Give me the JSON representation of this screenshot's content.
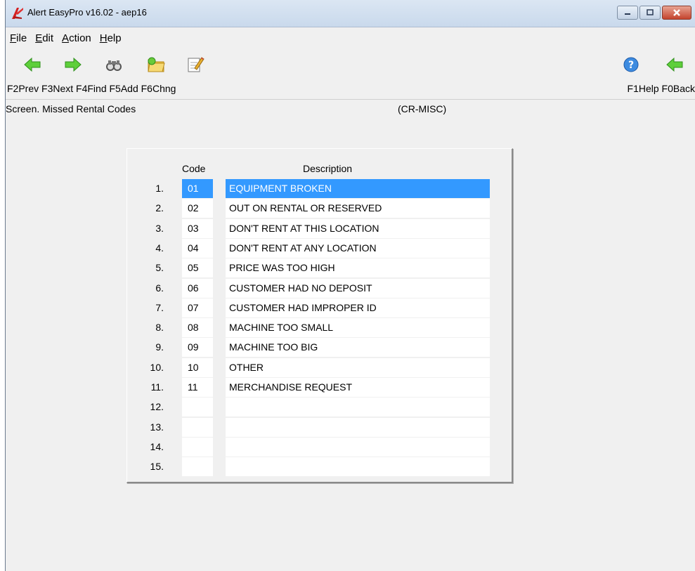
{
  "window": {
    "title": "Alert EasyPro v16.02 - aep16"
  },
  "menu": [
    {
      "label": "File",
      "key": "F",
      "rest": "ile"
    },
    {
      "label": "Edit",
      "key": "E",
      "rest": "dit"
    },
    {
      "label": "Action",
      "key": "A",
      "rest": "ction"
    },
    {
      "label": "Help",
      "key": "H",
      "rest": "elp"
    }
  ],
  "toolbar": {
    "icons": [
      "arrow-left-icon",
      "arrow-right-icon",
      "binoculars-icon",
      "folder-add-icon",
      "notepad-edit-icon",
      "help-icon",
      "back-arrow-icon"
    ],
    "fkeys_left": "F2Prev F3Next F4Find F5Add F6Chng",
    "fkeys_right": "F1Help F0Back"
  },
  "screen": {
    "title": "Screen. Missed Rental Codes",
    "code": "(CR-MISC)"
  },
  "table": {
    "headers": {
      "code": "Code",
      "description": "Description"
    },
    "rows": [
      {
        "num": "1.",
        "code": "01",
        "desc": "EQUIPMENT BROKEN",
        "selected": true
      },
      {
        "num": "2.",
        "code": "02",
        "desc": "OUT ON RENTAL OR RESERVED"
      },
      {
        "num": "3.",
        "code": "03",
        "desc": "DON'T RENT AT THIS LOCATION"
      },
      {
        "num": "4.",
        "code": "04",
        "desc": "DON'T RENT AT ANY LOCATION"
      },
      {
        "num": "5.",
        "code": "05",
        "desc": "PRICE WAS TOO HIGH"
      },
      {
        "num": "6.",
        "code": "06",
        "desc": "CUSTOMER HAD NO DEPOSIT"
      },
      {
        "num": "7.",
        "code": "07",
        "desc": "CUSTOMER HAD IMPROPER ID"
      },
      {
        "num": "8.",
        "code": "08",
        "desc": "MACHINE TOO SMALL"
      },
      {
        "num": "9.",
        "code": "09",
        "desc": "MACHINE TOO BIG"
      },
      {
        "num": "10.",
        "code": "10",
        "desc": "OTHER"
      },
      {
        "num": "11.",
        "code": "11",
        "desc": "MERCHANDISE REQUEST"
      },
      {
        "num": "12.",
        "code": "",
        "desc": ""
      },
      {
        "num": "13.",
        "code": "",
        "desc": ""
      },
      {
        "num": "14.",
        "code": "",
        "desc": ""
      },
      {
        "num": "15.",
        "code": "",
        "desc": ""
      }
    ]
  },
  "colors": {
    "selection": "#3399ff",
    "arrow_green": "#5ecf3a"
  }
}
